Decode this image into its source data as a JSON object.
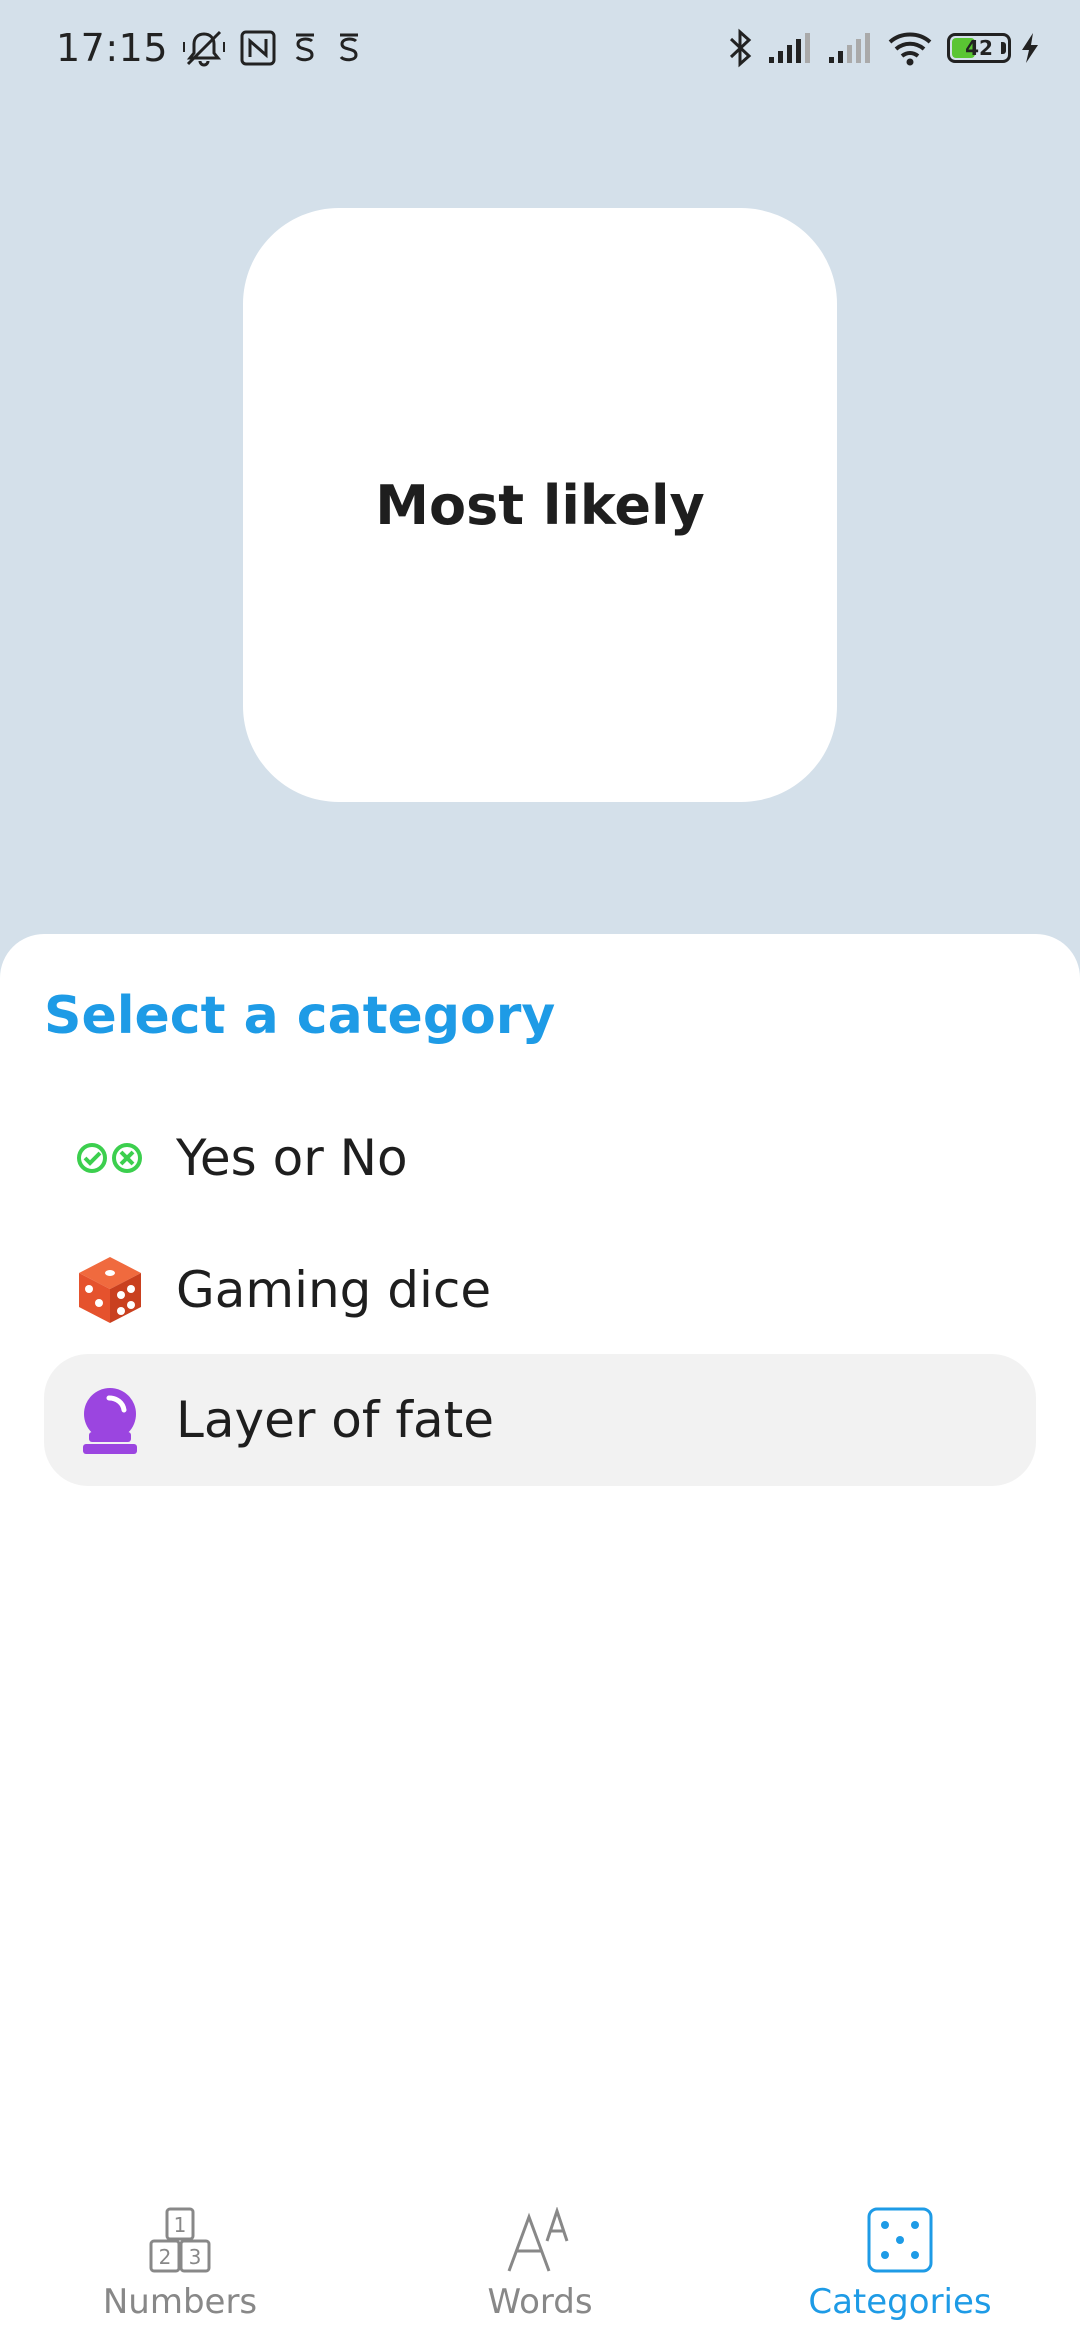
{
  "status_bar": {
    "time": "17:15",
    "battery_level": "42",
    "battery_percent": 42,
    "icons_left": [
      "mute-icon",
      "nfc-icon",
      "app-notification-icon",
      "app-notification-icon"
    ],
    "icons_right": [
      "bluetooth-icon",
      "signal-icon",
      "signal-icon",
      "wifi-icon",
      "battery-icon",
      "charging-icon"
    ]
  },
  "result": {
    "text": "Most likely"
  },
  "sheet": {
    "title": "Select a category",
    "categories": [
      {
        "label": "Yes or No",
        "icon": "yes-no-icon",
        "selected": false
      },
      {
        "label": "Gaming dice",
        "icon": "dice-icon",
        "selected": false
      },
      {
        "label": "Layer of fate",
        "icon": "crystal-ball-icon",
        "selected": true
      }
    ]
  },
  "bottom_nav": {
    "items": [
      {
        "label": "Numbers",
        "icon": "numbers-icon",
        "active": false
      },
      {
        "label": "Words",
        "icon": "words-icon",
        "active": false
      },
      {
        "label": "Categories",
        "icon": "categories-icon",
        "active": true
      }
    ]
  },
  "colors": {
    "accent": "#1e9be6",
    "background": "#d4e0ea",
    "yes_no": "#3ccf4e",
    "dice": "#e5522d",
    "crystal_ball": "#9b45e0"
  }
}
